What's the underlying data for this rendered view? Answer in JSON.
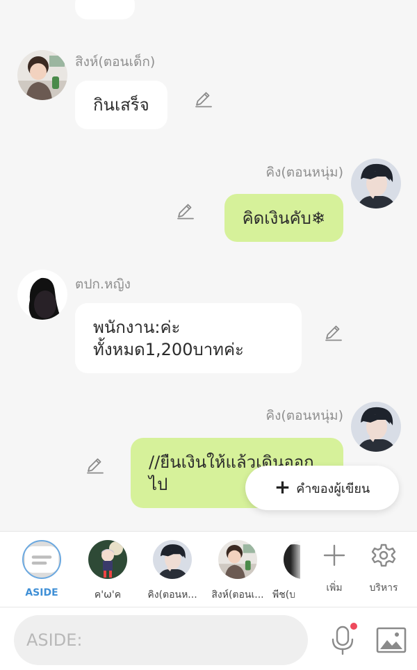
{
  "messages": [
    {
      "sender": "สิงห์(ตอนเด็ก)",
      "text": "กินเสร็จ",
      "side": "left",
      "avatar": "child-photo"
    },
    {
      "sender": "คิง(ตอนหนุ่ม)",
      "text": "คิดเงินคับ❄",
      "side": "right",
      "avatar": "young-man-illustration"
    },
    {
      "sender": "ตปก.หญิง",
      "text": "พนักงาน:ค่ะ\nทั้งหมด1,200บาทค่ะ",
      "side": "left",
      "avatar": "woman-silhouette"
    },
    {
      "sender": "คิง(ตอนหนุ่ม)",
      "text": "//ยืนเงินให้แล้วเดินออก\nไป",
      "side": "right",
      "avatar": "young-man-illustration"
    }
  ],
  "fab": {
    "label": "คำของผู้เขียน",
    "icon": "plus-icon"
  },
  "characters": [
    {
      "label": "ASIDE",
      "kind": "aside",
      "selected": true
    },
    {
      "label": "ค'ω'ค",
      "avatar": "anime-girl"
    },
    {
      "label": "คิง(ตอนห...",
      "avatar": "young-man-illustration"
    },
    {
      "label": "สิงห์(ตอนเ...",
      "avatar": "child-photo"
    },
    {
      "label": "พีช(บ",
      "avatar": "partial"
    }
  ],
  "tools": {
    "add_label": "เพิ่ม",
    "manage_label": "บริหาร"
  },
  "input": {
    "placeholder": "ASIDE:",
    "value": ""
  },
  "colors": {
    "outgoing_bubble": "#d6f19a",
    "incoming_bubble": "#ffffff",
    "accent": "#3f8fd6",
    "mic_dot": "#ee4a5c"
  }
}
